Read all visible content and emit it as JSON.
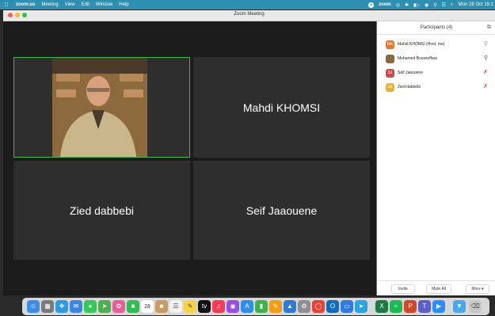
{
  "menubar": {
    "app": "zoom.us",
    "items": [
      "Meeting",
      "View",
      "Edit",
      "Window",
      "Help"
    ],
    "zoom_label": "zoom",
    "datetime": "Mon 28 Oct  15:1"
  },
  "window": {
    "title": "Zoom Meeting"
  },
  "tiles": [
    {
      "name": "Mahdi KHOMSI"
    },
    {
      "name": "Zied dabbebi"
    },
    {
      "name": "Seif Jaaouene"
    }
  ],
  "participants": {
    "header": "Participants (4)",
    "list": [
      {
        "initials": "MK",
        "name": "Mahdi KHOMSI (Host, me)",
        "color": "#e8782c",
        "muted": false
      },
      {
        "initials": "",
        "name": "Mohamed Boussoffara",
        "color": "#8a6a3a",
        "muted": false
      },
      {
        "initials": "SJ",
        "name": "Seif Jaaouene",
        "color": "#d64545",
        "muted": true
      },
      {
        "initials": "Zd",
        "name": "Zied dabbebi",
        "color": "#e8b32c",
        "muted": true
      }
    ],
    "invite": "Invite",
    "mute_all": "Mute All",
    "more": "More ▾"
  },
  "dock": {
    "calendar_day": "28"
  }
}
